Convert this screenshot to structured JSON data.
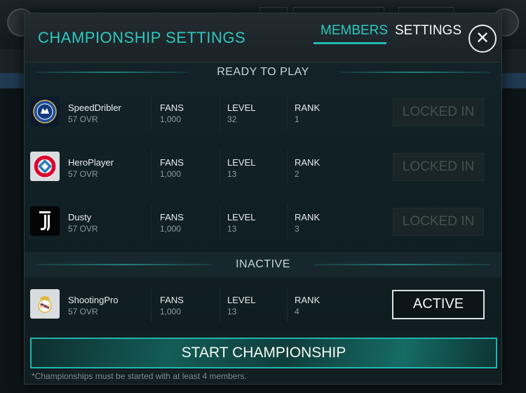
{
  "header": {
    "title": "CHAMPIONSHIP SETTINGS",
    "tabs": [
      {
        "label": "MEMBERS",
        "selected": true
      },
      {
        "label": "SETTINGS",
        "selected": false
      }
    ],
    "close_icon": "✕"
  },
  "sections": {
    "ready": "READY TO PLAY",
    "inactive": "INACTIVE"
  },
  "columns": {
    "fans": "FANS",
    "level": "LEVEL",
    "rank": "RANK"
  },
  "members": [
    {
      "name": "SpeedDribler",
      "ovr": "57 OVR",
      "fans": "1,000",
      "level": "32",
      "rank": "1",
      "status": "LOCKED IN",
      "crest": "chelsea-crest-icon"
    },
    {
      "name": "HeroPlayer",
      "ovr": "57 OVR",
      "fans": "1,000",
      "level": "13",
      "rank": "2",
      "status": "LOCKED IN",
      "crest": "bayern-crest-icon"
    },
    {
      "name": "Dusty",
      "ovr": "57 OVR",
      "fans": "1,000",
      "level": "13",
      "rank": "3",
      "status": "LOCKED IN",
      "crest": "juventus-crest-icon"
    },
    {
      "name": "ShootingPro",
      "ovr": "57 OVR",
      "fans": "1,000",
      "level": "13",
      "rank": "4",
      "status": "ACTIVE",
      "crest": "real-madrid-crest-icon"
    }
  ],
  "footer": {
    "start_label": "START CHAMPIONSHIP",
    "note": "*Championships must be started with at least 4 members."
  },
  "colors": {
    "accent": "#2ec8c0",
    "background": "#111e22"
  }
}
